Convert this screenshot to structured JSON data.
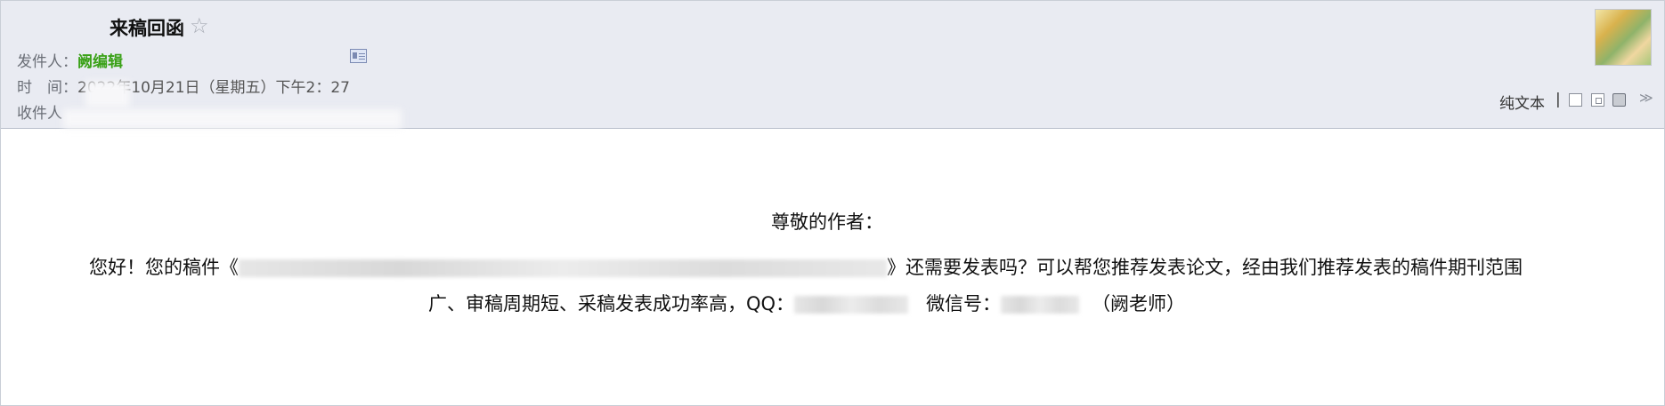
{
  "mail": {
    "subject": "来稿回函",
    "from_label": "发件人：",
    "from_name": "阙编辑",
    "time_label": "时　间：",
    "time_value": "2022年10月21日（星期五）下午2：27",
    "to_label": "收件人",
    "plaintext": "纯文本",
    "sep": "|"
  },
  "icons": {
    "star": "☆",
    "contact_card": "contact-card-icon",
    "chevron": "≫"
  },
  "body": {
    "salutation": "尊敬的作者：",
    "line1_prefix": "您好！您的稿件《",
    "line1_suffix": "》还需要发表吗？可以帮您推荐发表论文，经由我们推荐发表的稿件期刊范围",
    "line2_prefix": "广、审稿周期短、采稿发表成功率高，QQ：",
    "line2_mid": "微信号：",
    "line2_suffix": "（阙老师）"
  }
}
